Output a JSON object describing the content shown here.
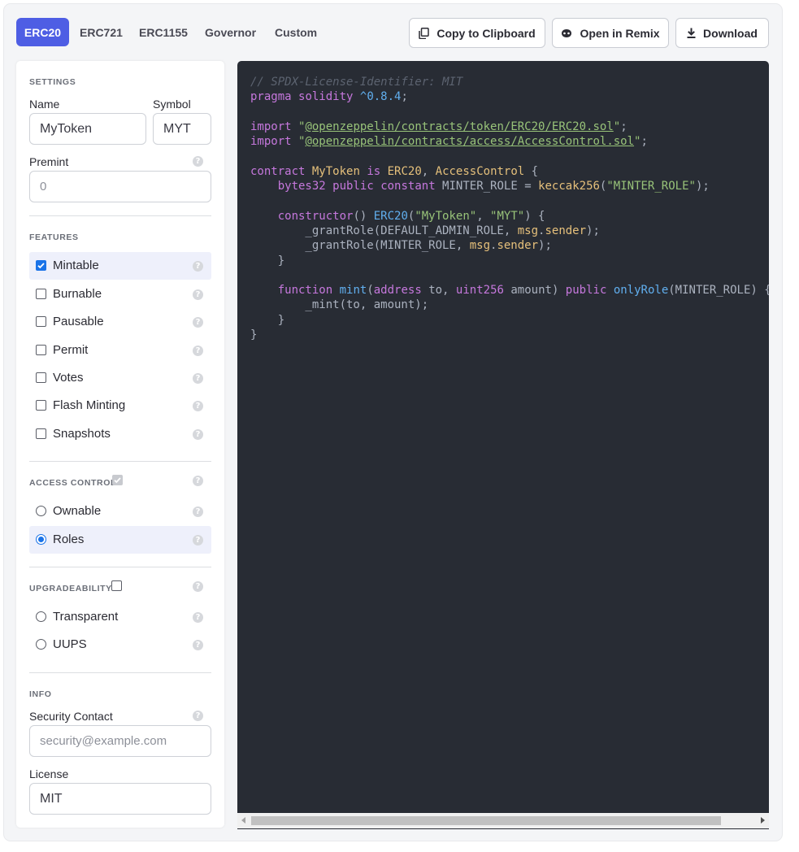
{
  "tabs": [
    {
      "label": "ERC20",
      "active": true
    },
    {
      "label": "ERC721",
      "active": false
    },
    {
      "label": "ERC1155",
      "active": false
    },
    {
      "label": "Governor",
      "active": false
    },
    {
      "label": "Custom",
      "active": false
    }
  ],
  "toolbar": {
    "copy_label": "Copy to Clipboard",
    "remix_label": "Open in Remix",
    "download_label": "Download"
  },
  "settings": {
    "heading": "SETTINGS",
    "name_label": "Name",
    "name_value": "MyToken",
    "symbol_label": "Symbol",
    "symbol_value": "MYT",
    "premint_label": "Premint",
    "premint_placeholder": "0"
  },
  "features": {
    "heading": "FEATURES",
    "items": [
      {
        "label": "Mintable",
        "checked": true
      },
      {
        "label": "Burnable",
        "checked": false
      },
      {
        "label": "Pausable",
        "checked": false
      },
      {
        "label": "Permit",
        "checked": false
      },
      {
        "label": "Votes",
        "checked": false
      },
      {
        "label": "Flash Minting",
        "checked": false
      },
      {
        "label": "Snapshots",
        "checked": false
      }
    ]
  },
  "access_control": {
    "heading": "ACCESS CONTROL",
    "enabled": true,
    "options": [
      {
        "label": "Ownable",
        "selected": false
      },
      {
        "label": "Roles",
        "selected": true
      }
    ]
  },
  "upgradeability": {
    "heading": "UPGRADEABILITY",
    "enabled": false,
    "options": [
      {
        "label": "Transparent",
        "selected": false
      },
      {
        "label": "UUPS",
        "selected": false
      }
    ]
  },
  "info": {
    "heading": "INFO",
    "security_label": "Security Contact",
    "security_placeholder": "security@example.com",
    "license_label": "License",
    "license_value": "MIT"
  },
  "help_glyph": "?",
  "code": {
    "lines": [
      "// SPDX-License-Identifier: MIT",
      "pragma solidity ^0.8.4;",
      "",
      "import \"@openzeppelin/contracts/token/ERC20/ERC20.sol\";",
      "import \"@openzeppelin/contracts/access/AccessControl.sol\";",
      "",
      "contract MyToken is ERC20, AccessControl {",
      "    bytes32 public constant MINTER_ROLE = keccak256(\"MINTER_ROLE\");",
      "",
      "    constructor() ERC20(\"MyToken\", \"MYT\") {",
      "        _grantRole(DEFAULT_ADMIN_ROLE, msg.sender);",
      "        _grantRole(MINTER_ROLE, msg.sender);",
      "    }",
      "",
      "    function mint(address to, uint256 amount) public onlyRole(MINTER_ROLE) {",
      "        _mint(to, amount);",
      "    }",
      "}"
    ]
  },
  "colors": {
    "accent": "#4e5ee4",
    "code_bg": "#282c34",
    "checkbox": "#1a73e8"
  }
}
